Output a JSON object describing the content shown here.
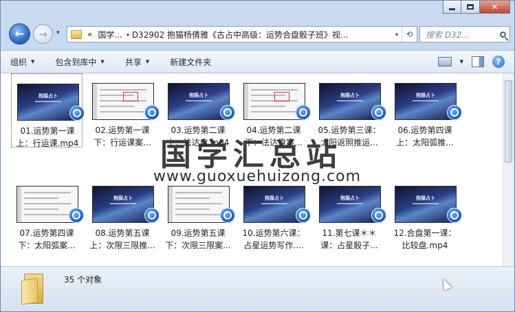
{
  "window": {
    "controls": {
      "minimize": "—",
      "maximize": "□",
      "close": "✕"
    }
  },
  "nav": {
    "back_glyph": "←",
    "forward_glyph": "→",
    "history_glyph": "▾",
    "address": {
      "chevron": "«",
      "segment1": "国学...",
      "arrow": "▸",
      "segment2": "D32902  抱猫杨倩雅《古占中高级：运势合盘骰子班》视...",
      "dropdown_glyph": "▾",
      "refresh_glyph": "⟲"
    },
    "search_placeholder": "搜索 D32..."
  },
  "toolbar": {
    "organize": "组织",
    "include_library": "包含到库中",
    "share": "共享",
    "new_folder": "新建文件夹",
    "help_glyph": "?"
  },
  "files": [
    {
      "line1": "01.运势第一课",
      "line2": "上：行运课.mp4",
      "thumb": "dark",
      "thumb_title": "抱猫占卜"
    },
    {
      "line1": "02.运势第一课",
      "line2": "下：行运课案...",
      "thumb": "doc"
    },
    {
      "line1": "03.运势第二课",
      "line2": "上：法达盘.mp4",
      "thumb": "dark",
      "thumb_title": "抱猫占卜"
    },
    {
      "line1": "04.运势第二课",
      "line2": "下：法达盘案...",
      "thumb": "doc"
    },
    {
      "line1": "05.运势第三课：",
      "line2": "太阳返照推运...",
      "thumb": "dark",
      "thumb_title": "抱猫占卜"
    },
    {
      "line1": "06.运势第四课",
      "line2": "上：太阳弧推...",
      "thumb": "dark",
      "thumb_title": "抱猫占卜"
    },
    {
      "line1": "07.运势第四课",
      "line2": "下：太阳弧案...",
      "thumb": "doc"
    },
    {
      "line1": "08.运势第五课",
      "line2": "上：次限三限推...",
      "thumb": "dark",
      "thumb_title": "抱猫占卜"
    },
    {
      "line1": "09.运势第五课",
      "line2": "下：次限三限案...",
      "thumb": "doc"
    },
    {
      "line1": "10.运势第六课：",
      "line2": "占星运势写作....",
      "thumb": "dark",
      "thumb_title": "抱猫占卜"
    },
    {
      "line1": "11.第七课＊＊",
      "line2": "课：占星骰子...",
      "thumb": "dark",
      "thumb_title": "抱猫占卜"
    },
    {
      "line1": "12.合盘第一课：",
      "line2": "比较盘.mp4",
      "thumb": "dark",
      "thumb_title": "抱猫占卜"
    }
  ],
  "watermark": {
    "cn": "国学汇总站",
    "url": "www.guoxuehuizong.com"
  },
  "details": {
    "count": "35 个对象"
  }
}
